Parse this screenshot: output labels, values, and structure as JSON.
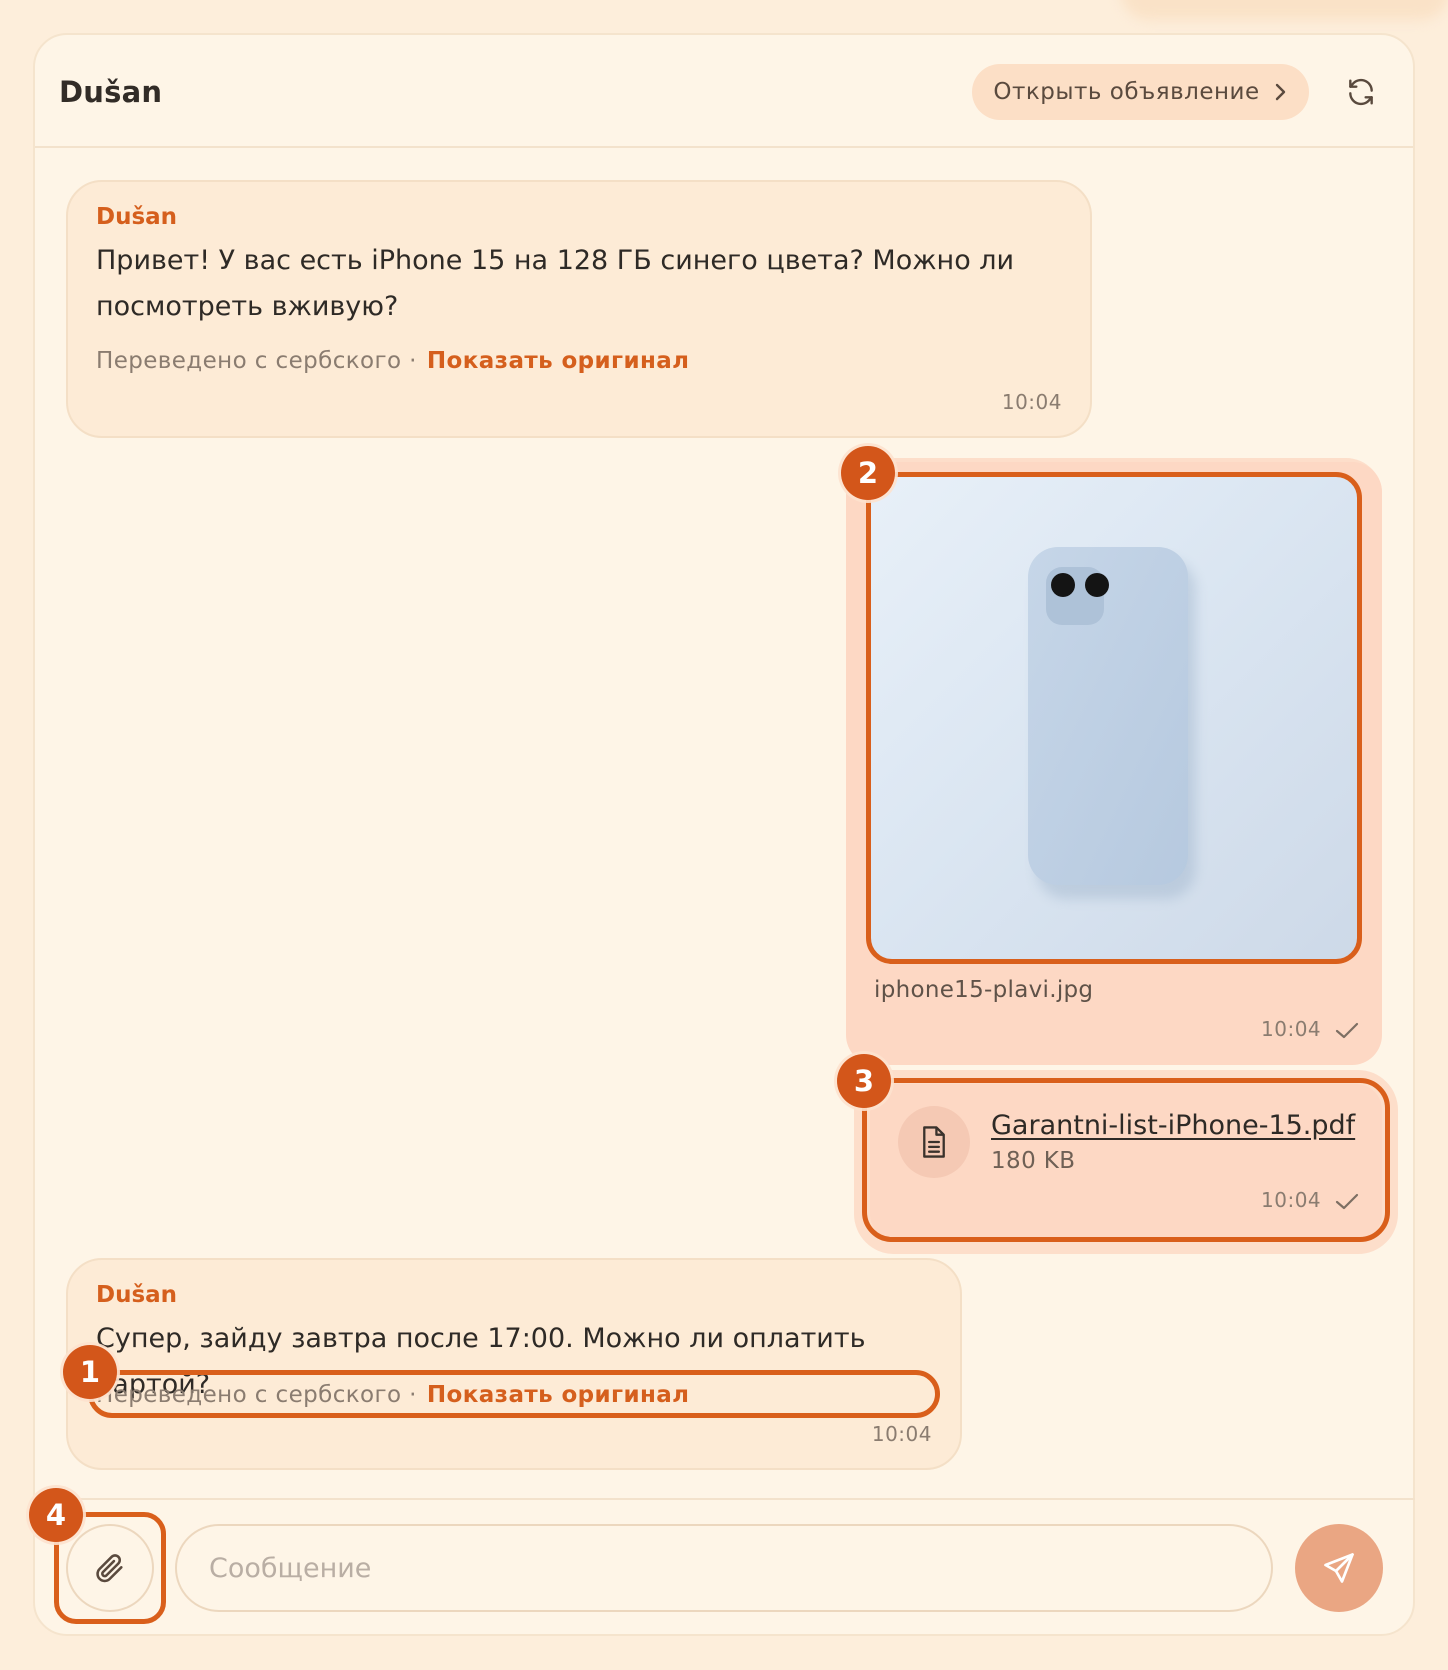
{
  "header": {
    "title": "Dušan",
    "open_listing_label": "Открыть объявление"
  },
  "messages": {
    "m1": {
      "sender": "Dušan",
      "text_line1": "Привет! У вас есть iPhone 15 на 128 ГБ синего цвета? Можно ли",
      "text_line2": "посмотреть вживую?",
      "translated_label": "Переведено с сербского ·",
      "show_original_label": "Показать оригинал",
      "time": "10:04"
    },
    "m2": {
      "file_name": "iphone15-plavi.jpg",
      "time": "10:04"
    },
    "m3": {
      "file_name": "Garantni-list-iPhone-15.pdf",
      "file_size": "180 KB",
      "time": "10:04"
    },
    "m4": {
      "sender": "Dušan",
      "text": "Супер, зайду завтра после 17:00. Можно ли оплатить картой?",
      "translated_label": "Переведено с сербского ·",
      "show_original_label": "Показать оригинал",
      "time": "10:04"
    }
  },
  "annotations": [
    "1",
    "2",
    "3",
    "4"
  ],
  "composer": {
    "placeholder": "Сообщение"
  },
  "icons": {
    "refresh": "refresh-icon",
    "chevron": "chevron-right-icon",
    "attach": "paperclip-icon",
    "send": "send-icon",
    "file": "document-icon",
    "check": "check-icon"
  },
  "colors": {
    "accent": "#d55f1d",
    "highlight": "#d95f1b",
    "background": "#fef5e7",
    "incoming_bubble": "#fdebd6",
    "outgoing_bubble": "#fdd8c4",
    "send_button": "#eaa683"
  }
}
